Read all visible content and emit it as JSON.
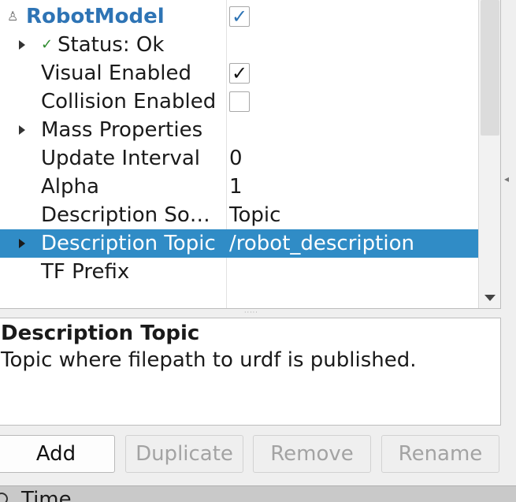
{
  "tree": {
    "root": {
      "icon": "robot-icon",
      "label": "RobotModel",
      "checked": true,
      "color": "#2e74b5"
    },
    "rows": [
      {
        "name": "Status: Ok",
        "value": ""
      },
      {
        "name": "Visual Enabled",
        "value": ""
      },
      {
        "name": "Collision Enabled",
        "value": ""
      },
      {
        "name": "Mass Properties",
        "value": ""
      },
      {
        "name": "Update Interval",
        "value": "0"
      },
      {
        "name": "Alpha",
        "value": "1"
      },
      {
        "name": "Description So…",
        "value": "Topic"
      },
      {
        "name": "Description Topic",
        "value": "/robot_description"
      },
      {
        "name": "TF Prefix",
        "value": ""
      }
    ],
    "selected_color": "#308cc6"
  },
  "description": {
    "title": "Description Topic",
    "text": "Topic where filepath to urdf is published."
  },
  "buttons": {
    "add": "Add",
    "duplicate": "Duplicate",
    "remove": "Remove",
    "rename": "Rename"
  },
  "bottom": {
    "label": "Time"
  }
}
